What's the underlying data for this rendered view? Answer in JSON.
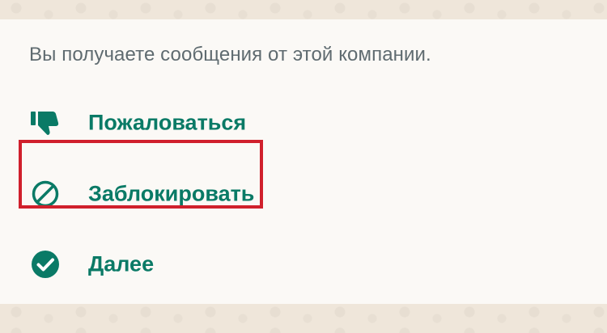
{
  "info_text": "Вы получаете сообщения от этой компании.",
  "options": [
    {
      "label": "Пожаловаться",
      "icon": "thumbs-down-icon"
    },
    {
      "label": "Заблокировать",
      "icon": "block-icon"
    },
    {
      "label": "Далее",
      "icon": "check-circle-icon"
    }
  ],
  "colors": {
    "accent": "#0a7a66",
    "highlight": "#d0202c",
    "text_muted": "#5f6b70",
    "card_bg": "#fbf9f6",
    "wallpaper": "#efe6da"
  }
}
